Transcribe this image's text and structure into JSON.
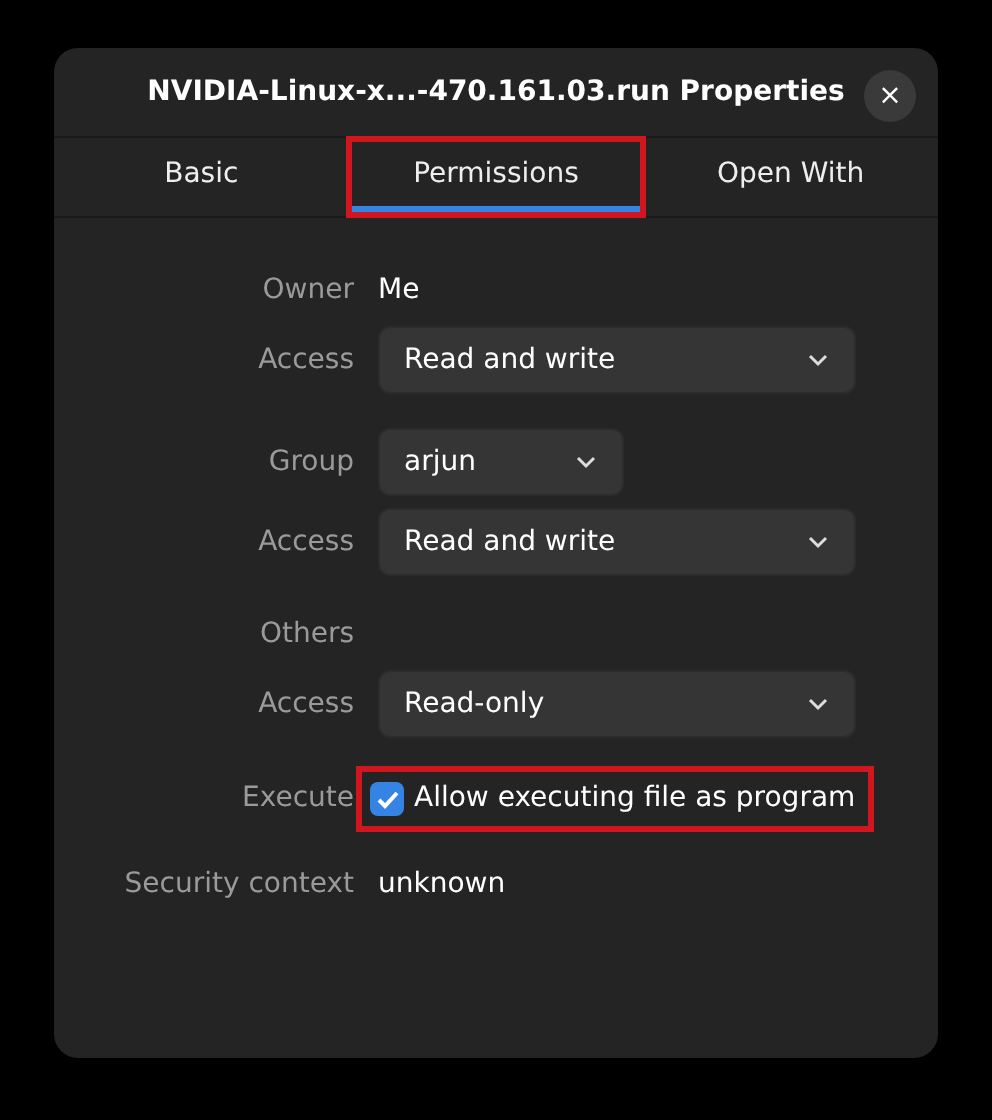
{
  "window": {
    "title": "NVIDIA-Linux-x...-470.161.03.run Properties",
    "close": "×"
  },
  "tabs": [
    {
      "label": "Basic",
      "selected": false,
      "highlighted": false
    },
    {
      "label": "Permissions",
      "selected": true,
      "highlighted": true
    },
    {
      "label": "Open With",
      "selected": false,
      "highlighted": false
    }
  ],
  "sections": [
    {
      "rows": [
        {
          "kind": "text",
          "label": "Owner",
          "value": "Me"
        },
        {
          "kind": "dropdown",
          "label": "Access",
          "value": "Read and write",
          "wide": true
        }
      ]
    },
    {
      "rows": [
        {
          "kind": "dropdown",
          "label": "Group",
          "value": "arjun",
          "wide": false
        },
        {
          "kind": "dropdown",
          "label": "Access",
          "value": "Read and write",
          "wide": true
        }
      ]
    },
    {
      "rows": [
        {
          "kind": "heading",
          "label": "Others"
        },
        {
          "kind": "dropdown",
          "label": "Access",
          "value": "Read-only",
          "wide": true
        }
      ]
    },
    {
      "rows": [
        {
          "kind": "checkbox",
          "label": "Execute",
          "value": "Allow executing file as program",
          "checked": true,
          "highlighted": true
        }
      ]
    },
    {
      "rows": [
        {
          "kind": "text",
          "label": "Security context",
          "value": "unknown"
        }
      ]
    }
  ]
}
